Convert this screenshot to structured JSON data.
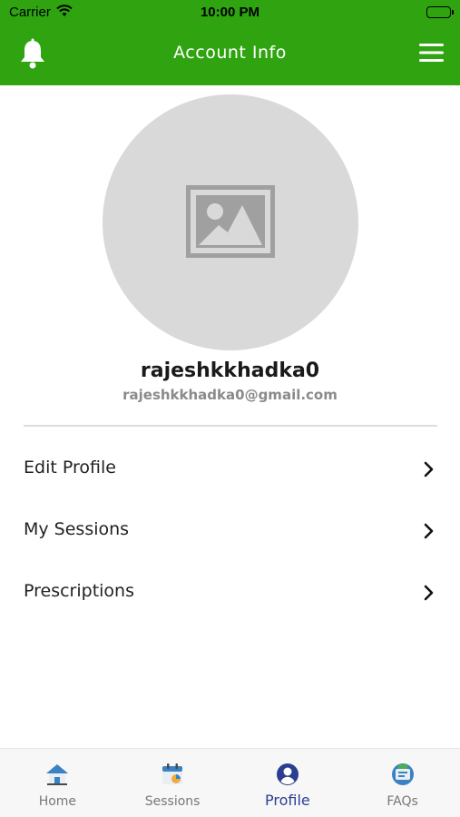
{
  "status_bar": {
    "carrier": "Carrier",
    "time": "10:00 PM"
  },
  "header": {
    "title": "Account Info",
    "left_icon": "bell-icon",
    "right_icon": "hamburger-menu-icon"
  },
  "profile": {
    "username": "rajeshkkhadka0",
    "email": "rajeshkkhadka0@gmail.com",
    "avatar_icon": "image-placeholder-icon"
  },
  "menu": {
    "items": [
      {
        "label": "Edit Profile"
      },
      {
        "label": "My Sessions"
      },
      {
        "label": "Prescriptions"
      }
    ]
  },
  "tabs": [
    {
      "label": "Home",
      "icon": "home-icon",
      "active": false
    },
    {
      "label": "Sessions",
      "icon": "calendar-icon",
      "active": false
    },
    {
      "label": "Profile",
      "icon": "profile-icon",
      "active": true
    },
    {
      "label": "FAQs",
      "icon": "faq-icon",
      "active": false
    }
  ],
  "colors": {
    "brand_green": "#2fa410",
    "active_tab": "#2c3e90",
    "avatar_bg": "#d9d9d9"
  }
}
